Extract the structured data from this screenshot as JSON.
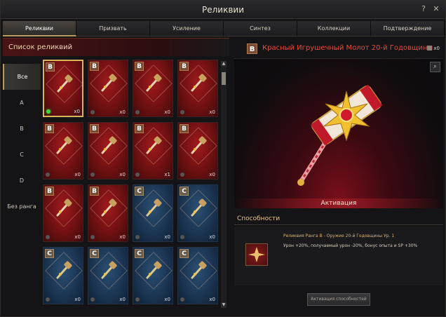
{
  "window": {
    "title": "Реликвии",
    "help_glyph": "?",
    "close_glyph": "✕"
  },
  "tabs": [
    {
      "label": "Реликвии",
      "active": true
    },
    {
      "label": "Призвать",
      "active": false
    },
    {
      "label": "Усиление",
      "active": false
    },
    {
      "label": "Синтез",
      "active": false
    },
    {
      "label": "Коллекции",
      "active": false
    },
    {
      "label": "Подтверждение",
      "active": false
    }
  ],
  "list": {
    "title": "Список реликвий",
    "filters": [
      {
        "label": "Все",
        "active": true
      },
      {
        "label": "A",
        "active": false
      },
      {
        "label": "B",
        "active": false
      },
      {
        "label": "C",
        "active": false
      },
      {
        "label": "D",
        "active": false
      },
      {
        "label": "Без ранга",
        "active": false
      }
    ],
    "cards": [
      {
        "rank": "B",
        "count": "x0",
        "color": "red",
        "selected": true,
        "active_dot": true,
        "icon": "hammer-icon"
      },
      {
        "rank": "B",
        "count": "x0",
        "color": "red",
        "selected": false,
        "active_dot": false,
        "icon": "axe-icon"
      },
      {
        "rank": "B",
        "count": "x0",
        "color": "red",
        "selected": false,
        "active_dot": false,
        "icon": "staff-icon"
      },
      {
        "rank": "B",
        "count": "x0",
        "color": "red",
        "selected": false,
        "active_dot": false,
        "icon": "sword-icon"
      },
      {
        "rank": "B",
        "count": "x0",
        "color": "red",
        "selected": false,
        "active_dot": false,
        "icon": "blade-icon"
      },
      {
        "rank": "B",
        "count": "x0",
        "color": "red",
        "selected": false,
        "active_dot": false,
        "icon": "bow-icon"
      },
      {
        "rank": "B",
        "count": "x1",
        "color": "red",
        "selected": false,
        "active_dot": false,
        "icon": "dagger-icon"
      },
      {
        "rank": "B",
        "count": "x0",
        "color": "red",
        "selected": false,
        "active_dot": false,
        "icon": "mace-icon"
      },
      {
        "rank": "B",
        "count": "x0",
        "color": "red",
        "selected": false,
        "active_dot": false,
        "icon": "spear-icon"
      },
      {
        "rank": "B",
        "count": "x0",
        "color": "red",
        "selected": false,
        "active_dot": false,
        "icon": "wand-icon"
      },
      {
        "rank": "C",
        "count": "x0",
        "color": "blue",
        "selected": false,
        "active_dot": false,
        "icon": "crossbow-icon"
      },
      {
        "rank": "C",
        "count": "x0",
        "color": "blue",
        "selected": false,
        "active_dot": false,
        "icon": "rapier-icon"
      },
      {
        "rank": "C",
        "count": "x0",
        "color": "blue",
        "selected": false,
        "active_dot": false,
        "icon": "greatsword-icon"
      },
      {
        "rank": "C",
        "count": "x0",
        "color": "blue",
        "selected": false,
        "active_dot": false,
        "icon": "halberd-icon"
      },
      {
        "rank": "C",
        "count": "x0",
        "color": "blue",
        "selected": false,
        "active_dot": false,
        "icon": "knife-icon"
      },
      {
        "rank": "C",
        "count": "x0",
        "color": "blue",
        "selected": false,
        "active_dot": false,
        "icon": "scepter-icon"
      }
    ]
  },
  "detail": {
    "rank": "B",
    "title": "Красный Игрушечный Молот 20-й Годовщины",
    "count": "x0",
    "activation_label": "Активация",
    "abilities_title": "Способности",
    "ability_name": "Реликвия Ранга B - Оружие 20-й Годовщины Ур. 1",
    "ability_desc": "Урон +20%, получаемый урон -20%, бонус опыта и SP +30%",
    "ability_button": "Активация способностей"
  },
  "colors": {
    "accent_gold": "#b89a5e",
    "title_red": "#e84a3a",
    "card_red": "#6e1012",
    "card_blue": "#1b3552"
  }
}
